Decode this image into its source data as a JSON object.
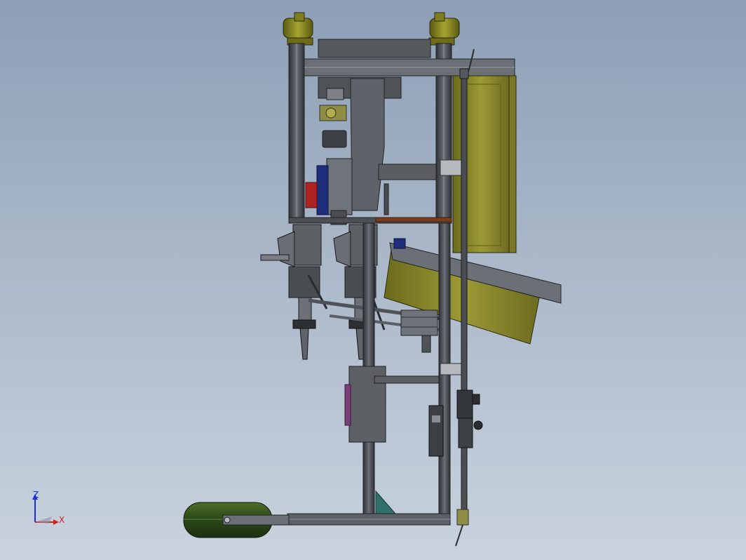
{
  "viewport": {
    "background_top": "#8d9fb6",
    "background_bottom": "#c9d3df"
  },
  "colors": {
    "frame_dark": "#3f4246",
    "frame_mid": "#5c6066",
    "frame_light": "#7a7f86",
    "olive": "#8d8a2c",
    "olive_light": "#a4a23a",
    "yellow_cap": "#8a8a1c",
    "blue_part": "#1f2e7a",
    "red_part": "#b02323",
    "brown_plate": "#7a3e1c",
    "tank_green": "#2f4d1b",
    "teal_wedge": "#2f6f6c",
    "purple_panel": "#7a3f78"
  },
  "triad": {
    "z_label": "Z",
    "x_label": "X",
    "z_color": "#1b2fd8",
    "x_color": "#d12020"
  },
  "icons": {
    "triad": "coordinate-triad-icon"
  }
}
